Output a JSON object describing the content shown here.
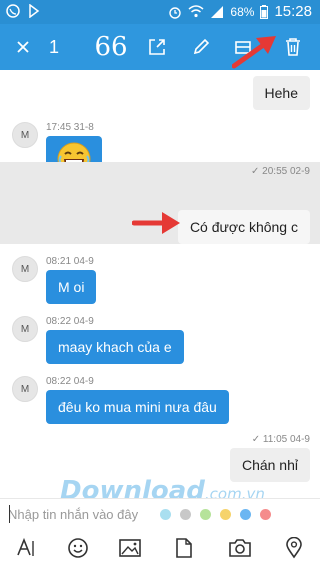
{
  "status_bar": {
    "battery_percent": "68%",
    "time": "15:28",
    "icons": [
      "viber-icon",
      "signal-icon",
      "alarm-icon",
      "wifi-icon",
      "cellular-icon",
      "battery-icon"
    ]
  },
  "action_bar": {
    "selected_count": "1",
    "quote_glyph": "66",
    "icons": [
      "close-icon",
      "quote-icon",
      "share-icon",
      "edit-icon",
      "copy-icon",
      "trash-icon"
    ],
    "background": "#2f97de"
  },
  "messages": [
    {
      "side": "out",
      "text": "Hehe"
    },
    {
      "side": "in",
      "avatar": "M",
      "timestamp": "17:45 31-8",
      "sticker": "laughing-emoji"
    },
    {
      "side": "out",
      "selected": true,
      "timestamp": "20:55 02-9",
      "text": "Có được không c"
    },
    {
      "side": "in",
      "avatar": "M",
      "timestamp": "08:21 04-9",
      "text": "M oi"
    },
    {
      "side": "in",
      "avatar": "M",
      "timestamp": "08:22 04-9",
      "text": "maay khach của e"
    },
    {
      "side": "in",
      "avatar": "M",
      "timestamp": "08:22 04-9",
      "text": "đêu ko mua mini nưa đâu"
    },
    {
      "side": "out",
      "timestamp": "11:05 04-9",
      "text": "Chán nhỉ"
    }
  ],
  "watermark": {
    "main": "Download",
    "suffix": ".com.vn"
  },
  "composer": {
    "placeholder": "Nhập tin nhắn vào đây",
    "value": "",
    "color_dots": [
      "#a9dff0",
      "#c8c8c8",
      "#b6e39a",
      "#f6d36b",
      "#6bb6f2",
      "#f58c8c"
    ]
  },
  "toolbar": {
    "icons": [
      "text-format-icon",
      "emoji-icon",
      "image-icon",
      "file-icon",
      "camera-icon",
      "location-icon"
    ]
  }
}
